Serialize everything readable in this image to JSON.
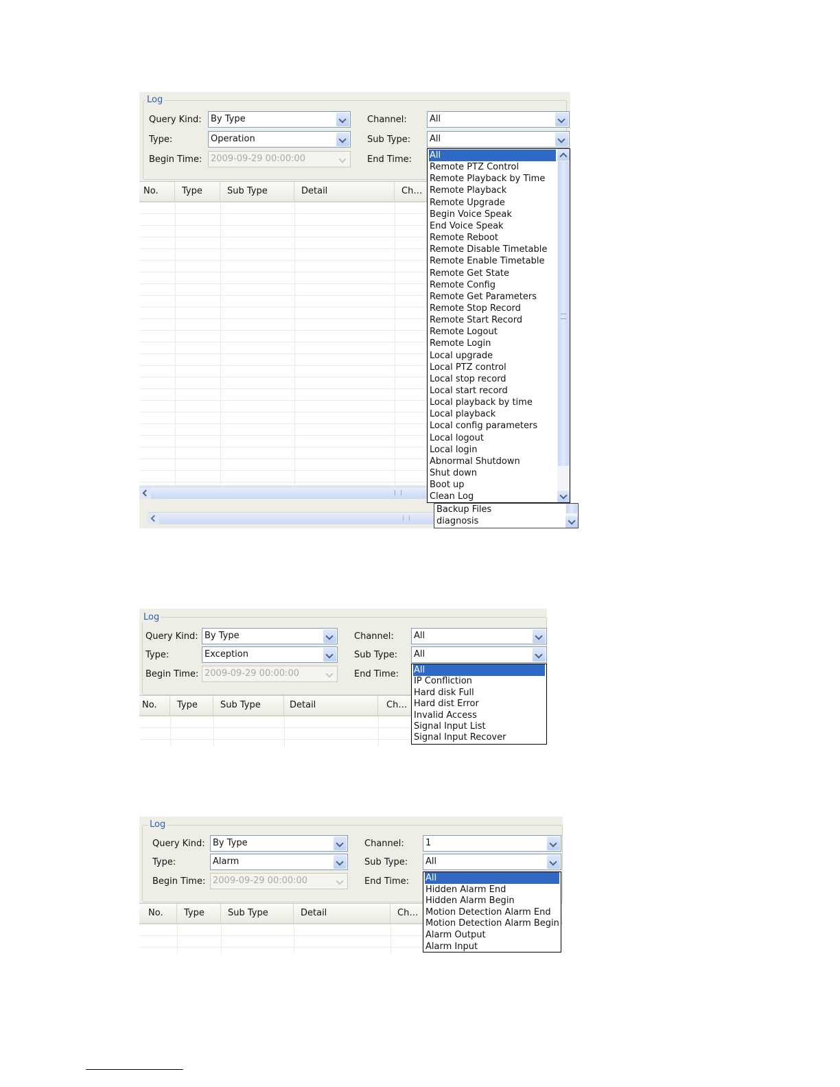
{
  "screens": [
    {
      "group_title": "Log",
      "labels": {
        "query_kind": "Query Kind:",
        "type": "Type:",
        "begin_time": "Begin Time:",
        "channel": "Channel:",
        "sub_type": "Sub Type:",
        "end_time": "End Time:"
      },
      "values": {
        "query_kind": "By Type",
        "type": "Operation",
        "begin_time": "2009-09-29 00:00:00",
        "channel": "All",
        "sub_type": "All"
      },
      "columns": [
        "No.",
        "Type",
        "Sub Type",
        "Detail",
        "Ch…"
      ],
      "dropdown_items": [
        "All",
        "Remote PTZ Control",
        "Remote Playback by Time",
        "Remote Playback",
        "Remote Upgrade",
        "Begin Voice Speak",
        "End Voice Speak",
        "Remote Reboot",
        "Remote Disable Timetable",
        "Remote Enable Timetable",
        "Remote Get State",
        "Remote Config",
        "Remote Get Parameters",
        "Remote Stop Record",
        "Remote Start Record",
        "Remote Logout",
        "Remote Login",
        "Local upgrade",
        "Local PTZ control",
        "Local stop record",
        "Local start record",
        "Local playback by time",
        "Local playback",
        "Local config parameters",
        "Local logout",
        "Local login",
        "Abnormal Shutdown",
        "Shut down",
        "Boot up",
        "Clean Log"
      ],
      "dropdown_extra_items": [
        "Backup Files",
        "diagnosis"
      ]
    },
    {
      "group_title": "Log",
      "labels": {
        "query_kind": "Query Kind:",
        "type": "Type:",
        "begin_time": "Begin Time:",
        "channel": "Channel:",
        "sub_type": "Sub Type:",
        "end_time": "End Time:"
      },
      "values": {
        "query_kind": "By Type",
        "type": "Exception",
        "begin_time": "2009-09-29 00:00:00",
        "channel": "All",
        "sub_type": "All"
      },
      "columns": [
        "No.",
        "Type",
        "Sub Type",
        "Detail",
        "Ch…"
      ],
      "dropdown_items": [
        "All",
        "IP Confliction",
        "Hard disk Full",
        "Hard dist Error",
        "Invalid Access",
        "Signal Input List",
        "Signal Input Recover"
      ]
    },
    {
      "group_title": "Log",
      "labels": {
        "query_kind": "Query Kind:",
        "type": "Type:",
        "begin_time": "Begin Time:",
        "channel": "Channel:",
        "sub_type": "Sub Type:",
        "end_time": "End Time:"
      },
      "values": {
        "query_kind": "By Type",
        "type": "Alarm",
        "begin_time": "2009-09-29 00:00:00",
        "channel": "1",
        "sub_type": "All"
      },
      "columns": [
        "No.",
        "Type",
        "Sub Type",
        "Detail",
        "Ch…"
      ],
      "dropdown_items": [
        "All",
        "Hidden Alarm End",
        "Hidden Alarm Begin",
        "Motion Detection Alarm End",
        "Motion Detection Alarm Begin",
        "Alarm Output",
        "Alarm Input"
      ]
    }
  ]
}
